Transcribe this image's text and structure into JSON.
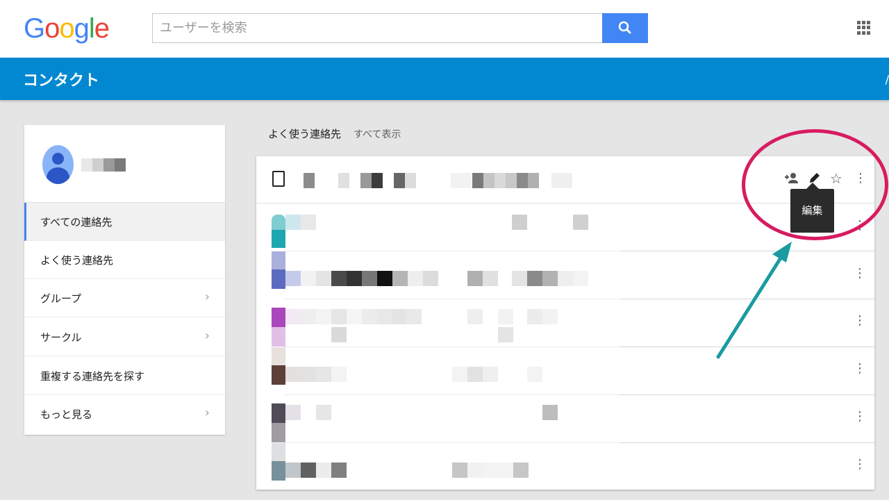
{
  "header": {
    "logo_letters": [
      "G",
      "o",
      "o",
      "g",
      "l",
      "e"
    ],
    "logo_colors": [
      "#4285f4",
      "#ea4335",
      "#fbbc05",
      "#4285f4",
      "#34a853",
      "#ea4335"
    ],
    "search_placeholder": "ユーザーを検索",
    "search_icon": "search-icon",
    "apps_icon": "apps-grid-icon"
  },
  "bluebar": {
    "title": "コンタクト",
    "edge_char": "/"
  },
  "sidebar": {
    "items": [
      {
        "label": "すべての連絡先",
        "active": true,
        "chevron": ""
      },
      {
        "label": "よく使う連絡先",
        "active": false,
        "chevron": ""
      },
      {
        "label": "グループ",
        "active": false,
        "chevron": "›"
      },
      {
        "label": "サークル",
        "active": false,
        "chevron": "›"
      },
      {
        "label": "重複する連絡先を探す",
        "active": false,
        "chevron": ""
      },
      {
        "label": "もっと見る",
        "active": false,
        "chevron": "›"
      }
    ]
  },
  "main": {
    "section_title": "よく使う連絡先",
    "show_all": "すべて表示",
    "header_icons": [
      "add-person-icon",
      "edit-pencil-icon",
      "star-icon",
      "more-vert-icon"
    ],
    "tooltip": "編集",
    "more_glyph": "⋮",
    "star_glyph": "☆",
    "add_glyph": "+👤"
  },
  "colors": {
    "accent_blue": "#0288d1",
    "search_button": "#4285f4",
    "annotation_circle": "#d81b60",
    "annotation_arrow": "#1a9ba1"
  }
}
